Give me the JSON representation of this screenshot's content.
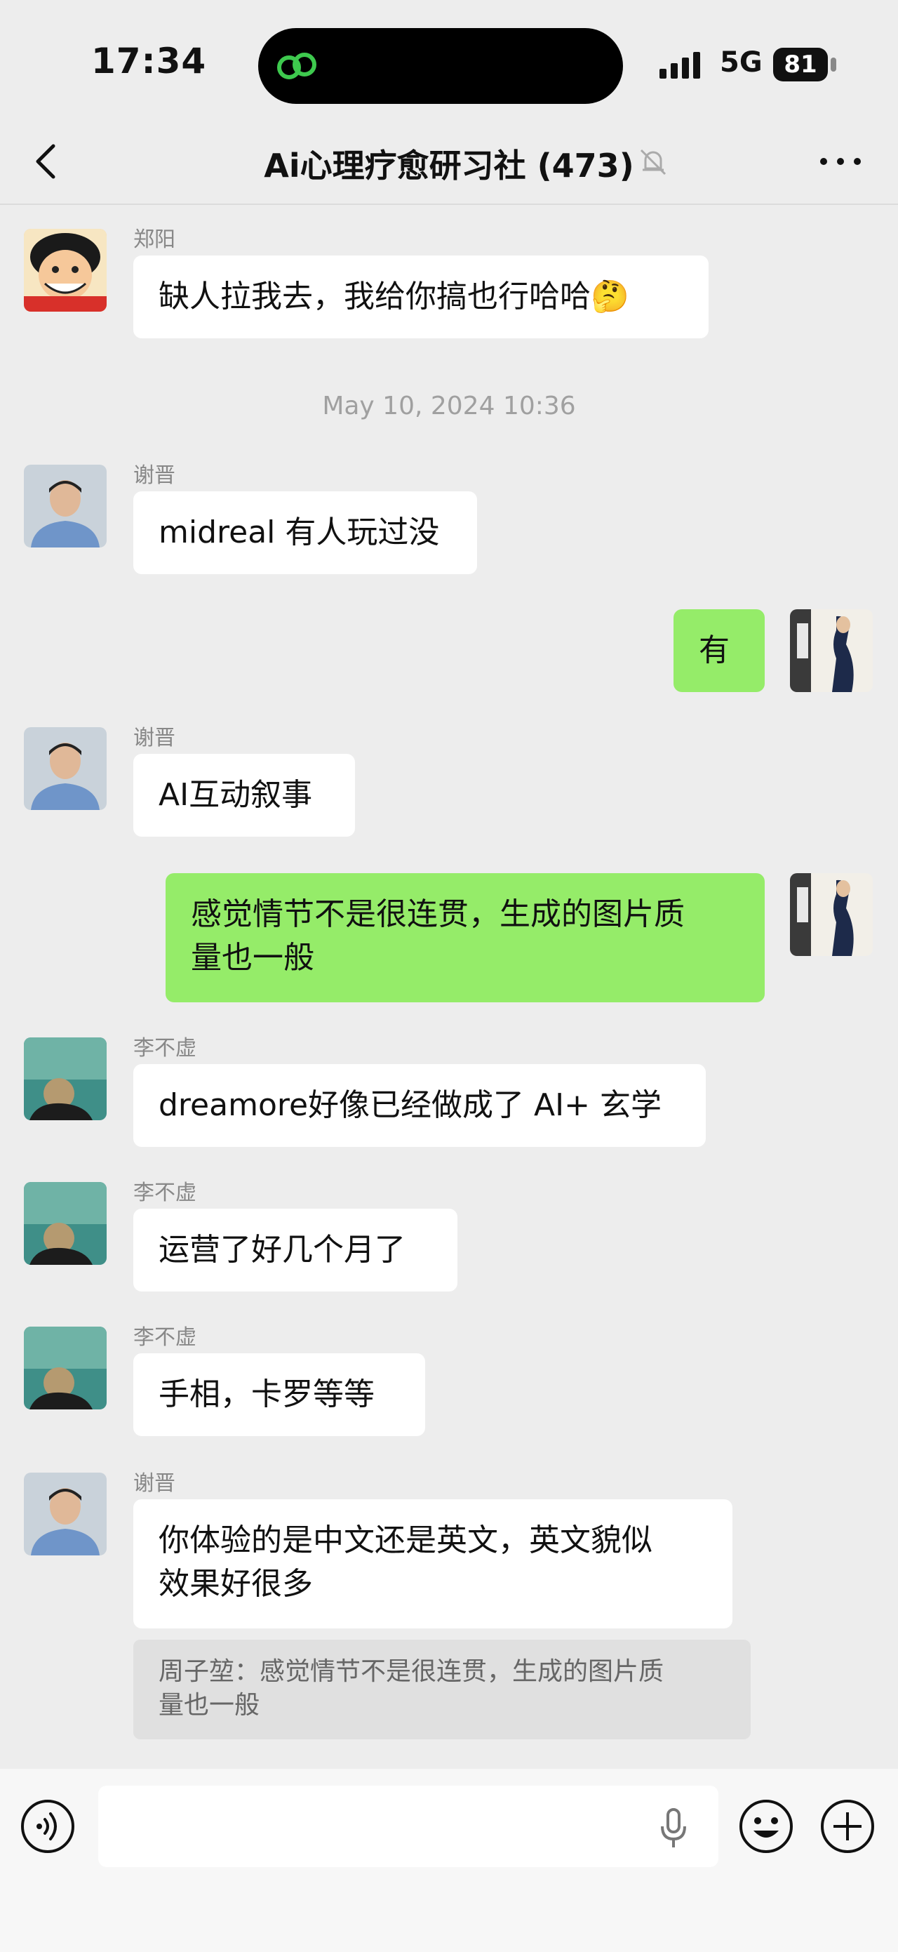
{
  "status": {
    "time": "17:34",
    "network": "5G",
    "battery": "81"
  },
  "header": {
    "title": "Ai心理疗愈研习社 (473)"
  },
  "timestamp": "May 10, 2024 10:36",
  "messages": [
    {
      "sender": "郑阳",
      "text": "缺人拉我去，我给你搞也行哈哈🤔"
    },
    {
      "sender": "谢晋",
      "text": "midreal 有人玩过没"
    },
    {
      "text": "有"
    },
    {
      "sender": "谢晋",
      "text": "AI互动叙事"
    },
    {
      "text_line1": "感觉情节不是很连贯，生成的图片质",
      "text_line2": "量也一般"
    },
    {
      "sender": "李不虚",
      "text": "dreamore好像已经做成了 AI+ 玄学"
    },
    {
      "sender": "李不虚",
      "text": "运营了好几个月了"
    },
    {
      "sender": "李不虚",
      "text": "手相，卡罗等等"
    },
    {
      "sender": "谢晋",
      "text_line1": "你体验的是中文还是英文，英文貌似",
      "text_line2": "效果好很多",
      "quote_line1": "周子堃：感觉情节不是很连贯，生成的图片质",
      "quote_line2": "量也一般"
    }
  ],
  "colors": {
    "me_bubble": "#95ec69",
    "other_bubble": "#ffffff",
    "background": "#ededed"
  },
  "icons": [
    "back-chevron-icon",
    "mute-bell-icon",
    "more-icon",
    "voice-icon",
    "mic-icon",
    "emoji-icon",
    "plus-icon"
  ]
}
